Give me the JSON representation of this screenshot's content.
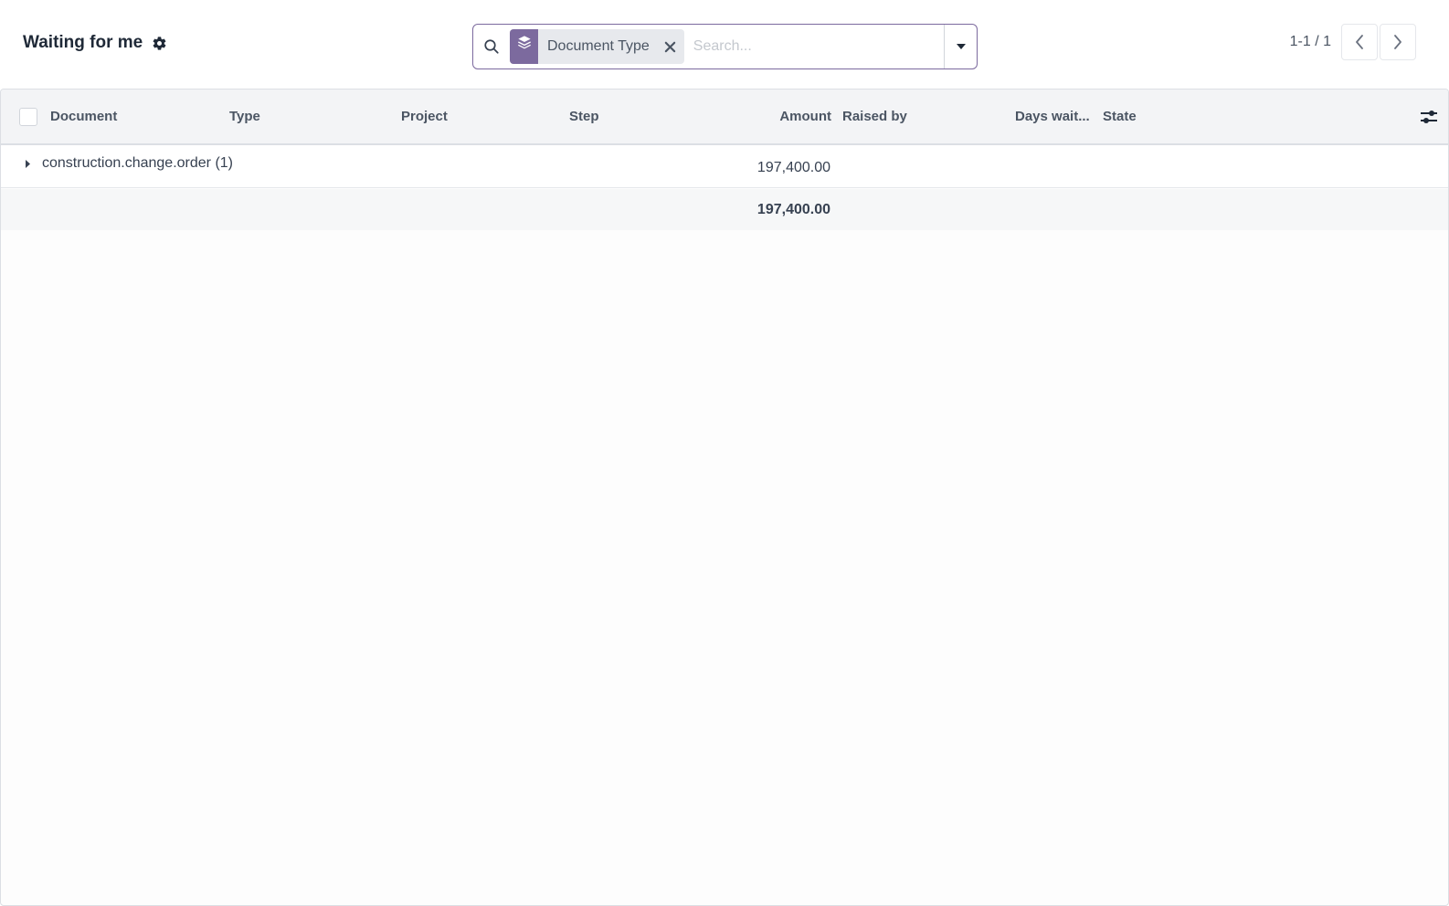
{
  "control_panel": {
    "title": "Waiting for me",
    "gear_icon": "gear-icon"
  },
  "search": {
    "facet_icon": "layers-icon",
    "facet_label": "Document Type",
    "placeholder": "Search...",
    "value": ""
  },
  "pager": {
    "value": "1-1 / 1"
  },
  "list": {
    "columns": {
      "document": "Document",
      "type": "Type",
      "project": "Project",
      "step": "Step",
      "amount": "Amount",
      "raised_by": "Raised by",
      "days_waiting": "Days wait...",
      "state": "State"
    },
    "group": {
      "label": "construction.change.order (1)",
      "amount": "197,400.00"
    },
    "footer": {
      "amount_total": "197,400.00"
    }
  },
  "colors": {
    "accent": "#7c6a9e",
    "header_bg": "#f3f4f6"
  }
}
